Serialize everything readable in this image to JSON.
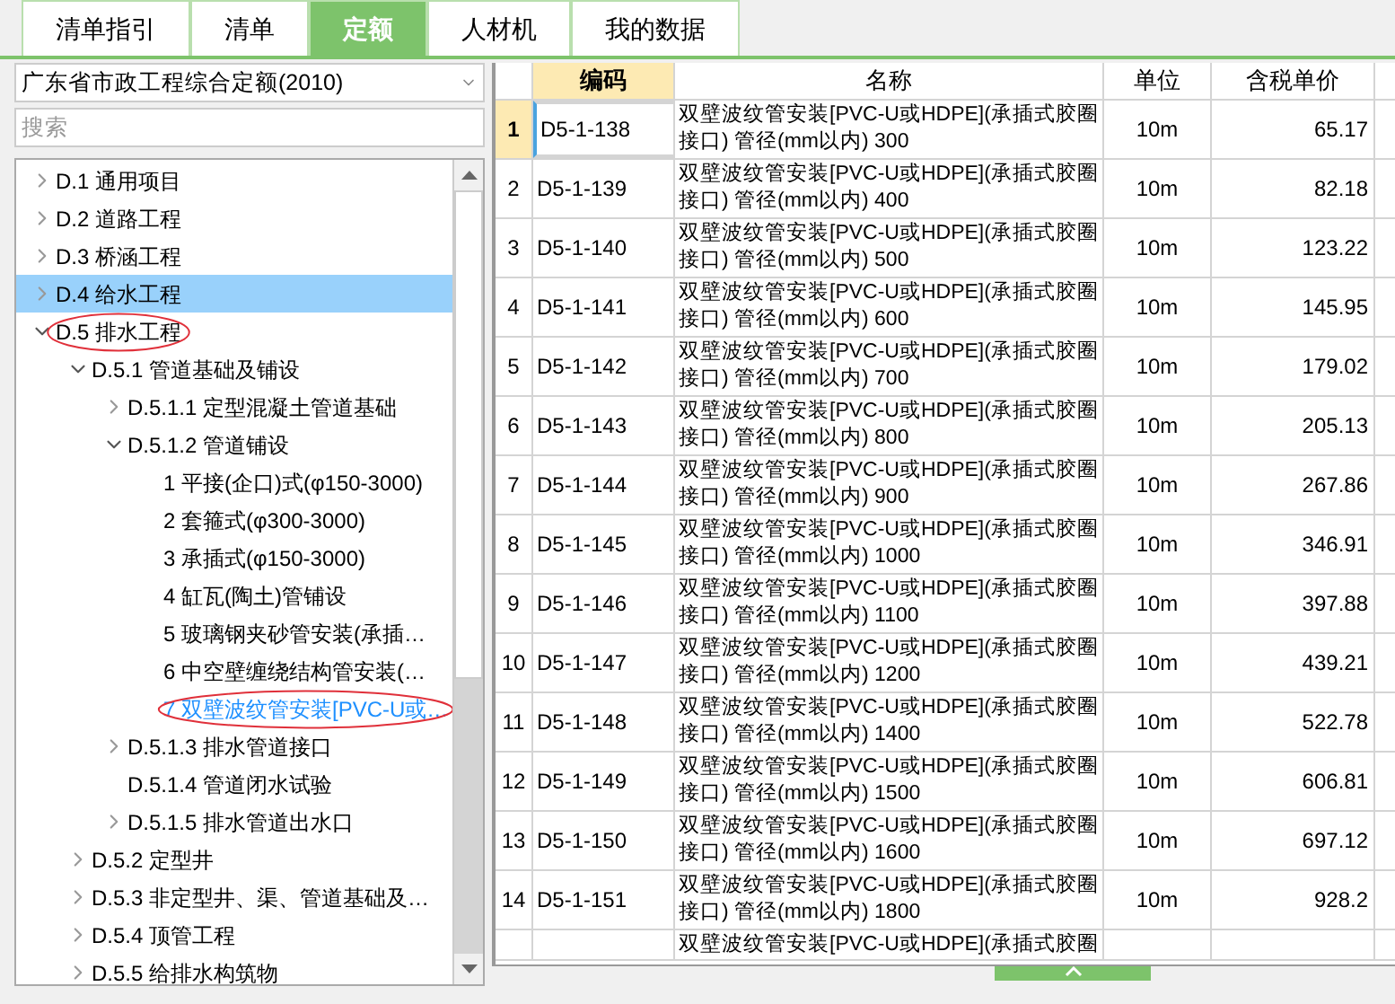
{
  "tabs": [
    {
      "label": "清单指引",
      "selected": false
    },
    {
      "label": "清单",
      "selected": false
    },
    {
      "label": "定额",
      "selected": true
    },
    {
      "label": "人材机",
      "selected": false
    },
    {
      "label": "我的数据",
      "selected": false
    }
  ],
  "library_select": {
    "value": "广东省市政工程综合定额(2010)"
  },
  "search": {
    "placeholder": "搜索"
  },
  "tree": [
    {
      "label": "D.1 通用项目",
      "expanded": false,
      "selected": false
    },
    {
      "label": "D.2 道路工程",
      "expanded": false,
      "selected": false
    },
    {
      "label": "D.3 桥涵工程",
      "expanded": false,
      "selected": false
    },
    {
      "label": "D.4 给水工程",
      "expanded": false,
      "selected": true
    },
    {
      "label": "D.5 排水工程",
      "expanded": true,
      "selected": false,
      "circled": true,
      "children": [
        {
          "label": "D.5.1 管道基础及铺设",
          "expanded": true,
          "selected": false,
          "children": [
            {
              "label": "D.5.1.1 定型混凝土管道基础",
              "expanded": false,
              "selected": false
            },
            {
              "label": "D.5.1.2 管道铺设",
              "expanded": true,
              "selected": false,
              "children": [
                {
                  "label": "1 平接(企口)式(φ150-3000)",
                  "selected": false
                },
                {
                  "label": "2 套箍式(φ300-3000)",
                  "selected": false
                },
                {
                  "label": "3 承插式(φ150-3000)",
                  "selected": false
                },
                {
                  "label": "4 缸瓦(陶土)管铺设",
                  "selected": false
                },
                {
                  "label": "5 玻璃钢夹砂管安装(承插…",
                  "selected": false
                },
                {
                  "label": "6 中空壁缠绕结构管安装(…",
                  "selected": false
                },
                {
                  "label": "7 双壁波纹管安装[PVC-U或…",
                  "selected": false,
                  "current": true,
                  "circled": true
                }
              ]
            },
            {
              "label": "D.5.1.3 排水管道接口",
              "expanded": false,
              "selected": false
            },
            {
              "label": "D.5.1.4 管道闭水试验",
              "selected": false
            },
            {
              "label": "D.5.1.5 排水管道出水口",
              "expanded": false,
              "selected": false
            }
          ]
        },
        {
          "label": "D.5.2 定型井",
          "expanded": false,
          "selected": false
        },
        {
          "label": "D.5.3 非定型井、渠、管道基础及…",
          "expanded": false,
          "selected": false
        },
        {
          "label": "D.5.4 顶管工程",
          "expanded": false,
          "selected": false
        },
        {
          "label": "D.5.5 给排水构筑物",
          "expanded": false,
          "selected": false
        }
      ]
    }
  ],
  "table": {
    "columns": [
      {
        "label": "编码",
        "selected": true
      },
      {
        "label": "名称",
        "selected": false
      },
      {
        "label": "单位",
        "selected": false
      },
      {
        "label": "含税单价",
        "selected": false
      }
    ],
    "rows": [
      {
        "no": "1",
        "code": "D5-1-138",
        "name": [
          "双壁波纹管安装[PVC-U或HDPE](承插式胶圈",
          "接口) 管径(mm以内) 300"
        ],
        "unit": "10m",
        "price": "65.17",
        "selected": true
      },
      {
        "no": "2",
        "code": "D5-1-139",
        "name": [
          "双壁波纹管安装[PVC-U或HDPE](承插式胶圈",
          "接口) 管径(mm以内) 400"
        ],
        "unit": "10m",
        "price": "82.18",
        "selected": false
      },
      {
        "no": "3",
        "code": "D5-1-140",
        "name": [
          "双壁波纹管安装[PVC-U或HDPE](承插式胶圈",
          "接口) 管径(mm以内) 500"
        ],
        "unit": "10m",
        "price": "123.22",
        "selected": false
      },
      {
        "no": "4",
        "code": "D5-1-141",
        "name": [
          "双壁波纹管安装[PVC-U或HDPE](承插式胶圈",
          "接口) 管径(mm以内) 600"
        ],
        "unit": "10m",
        "price": "145.95",
        "selected": false
      },
      {
        "no": "5",
        "code": "D5-1-142",
        "name": [
          "双壁波纹管安装[PVC-U或HDPE](承插式胶圈",
          "接口) 管径(mm以内) 700"
        ],
        "unit": "10m",
        "price": "179.02",
        "selected": false
      },
      {
        "no": "6",
        "code": "D5-1-143",
        "name": [
          "双壁波纹管安装[PVC-U或HDPE](承插式胶圈",
          "接口) 管径(mm以内) 800"
        ],
        "unit": "10m",
        "price": "205.13",
        "selected": false
      },
      {
        "no": "7",
        "code": "D5-1-144",
        "name": [
          "双壁波纹管安装[PVC-U或HDPE](承插式胶圈",
          "接口) 管径(mm以内) 900"
        ],
        "unit": "10m",
        "price": "267.86",
        "selected": false
      },
      {
        "no": "8",
        "code": "D5-1-145",
        "name": [
          "双壁波纹管安装[PVC-U或HDPE](承插式胶圈",
          "接口) 管径(mm以内) 1000"
        ],
        "unit": "10m",
        "price": "346.91",
        "selected": false
      },
      {
        "no": "9",
        "code": "D5-1-146",
        "name": [
          "双壁波纹管安装[PVC-U或HDPE](承插式胶圈",
          "接口) 管径(mm以内) 1100"
        ],
        "unit": "10m",
        "price": "397.88",
        "selected": false
      },
      {
        "no": "10",
        "code": "D5-1-147",
        "name": [
          "双壁波纹管安装[PVC-U或HDPE](承插式胶圈",
          "接口) 管径(mm以内) 1200"
        ],
        "unit": "10m",
        "price": "439.21",
        "selected": false
      },
      {
        "no": "11",
        "code": "D5-1-148",
        "name": [
          "双壁波纹管安装[PVC-U或HDPE](承插式胶圈",
          "接口) 管径(mm以内) 1400"
        ],
        "unit": "10m",
        "price": "522.78",
        "selected": false
      },
      {
        "no": "12",
        "code": "D5-1-149",
        "name": [
          "双壁波纹管安装[PVC-U或HDPE](承插式胶圈",
          "接口) 管径(mm以内) 1500"
        ],
        "unit": "10m",
        "price": "606.81",
        "selected": false
      },
      {
        "no": "13",
        "code": "D5-1-150",
        "name": [
          "双壁波纹管安装[PVC-U或HDPE](承插式胶圈",
          "接口) 管径(mm以内) 1600"
        ],
        "unit": "10m",
        "price": "697.12",
        "selected": false
      },
      {
        "no": "14",
        "code": "D5-1-151",
        "name": [
          "双壁波纹管安装[PVC-U或HDPE](承插式胶圈",
          "接口) 管径(mm以内) 1800"
        ],
        "unit": "10m",
        "price": "928.2",
        "selected": false
      },
      {
        "name": [
          "双壁波纹管安装[PVC-U或HDPE](承插式胶圈"
        ],
        "selected": false
      }
    ]
  }
}
